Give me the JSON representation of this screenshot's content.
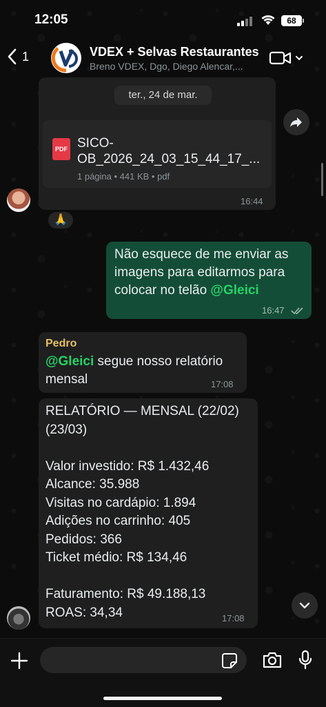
{
  "status_bar": {
    "time": "12:05",
    "battery": "68"
  },
  "header": {
    "back_count": "1",
    "title": "VDEX + Selvas Restaurantes",
    "subtitle": "Breno VDEX, Dgo, Diego Alencar,..."
  },
  "date_chip": "ter., 24 de mar.",
  "messages": {
    "pdf": {
      "icon_label": "PDF",
      "name_line1": "SICO-",
      "name_line2": "OB_2026_24_03_15_44_17_...",
      "meta": "1 página • 441 KB • pdf",
      "time": "16:44",
      "reaction": "🙏"
    },
    "outgoing": {
      "text_line1": "Não esquece de me enviar as",
      "text_line2": "imagens para editarmos para",
      "text_line3_prefix": "colocar no telão ",
      "mention": "@Gleici",
      "time": "16:47"
    },
    "pedro": {
      "sender": "Pedro",
      "mention": "@Gleici",
      "text_line1_suffix": " segue nosso relatório",
      "text_line2": "mensal",
      "time": "17:08"
    },
    "report": {
      "lines": [
        "RELATÓRIO — MENSAL (22/02)",
        "(23/03)",
        "",
        "Valor investido: R$ 1.432,46",
        "Alcance: 35.988",
        "Visitas no cardápio: 1.894",
        "Adições no carrinho: 405",
        "Pedidos: 366",
        "Ticket médio: R$ 134,46",
        "",
        "Faturamento: R$ 49.188,13",
        "ROAS: 34,34"
      ],
      "time": "17:08"
    }
  },
  "footer": {
    "input_value": ""
  },
  "colors": {
    "outgoing_bubble": "#144d37",
    "incoming_bubble": "#1f1f1f",
    "mention": "#25d366",
    "sender_name": "#e6c065"
  }
}
